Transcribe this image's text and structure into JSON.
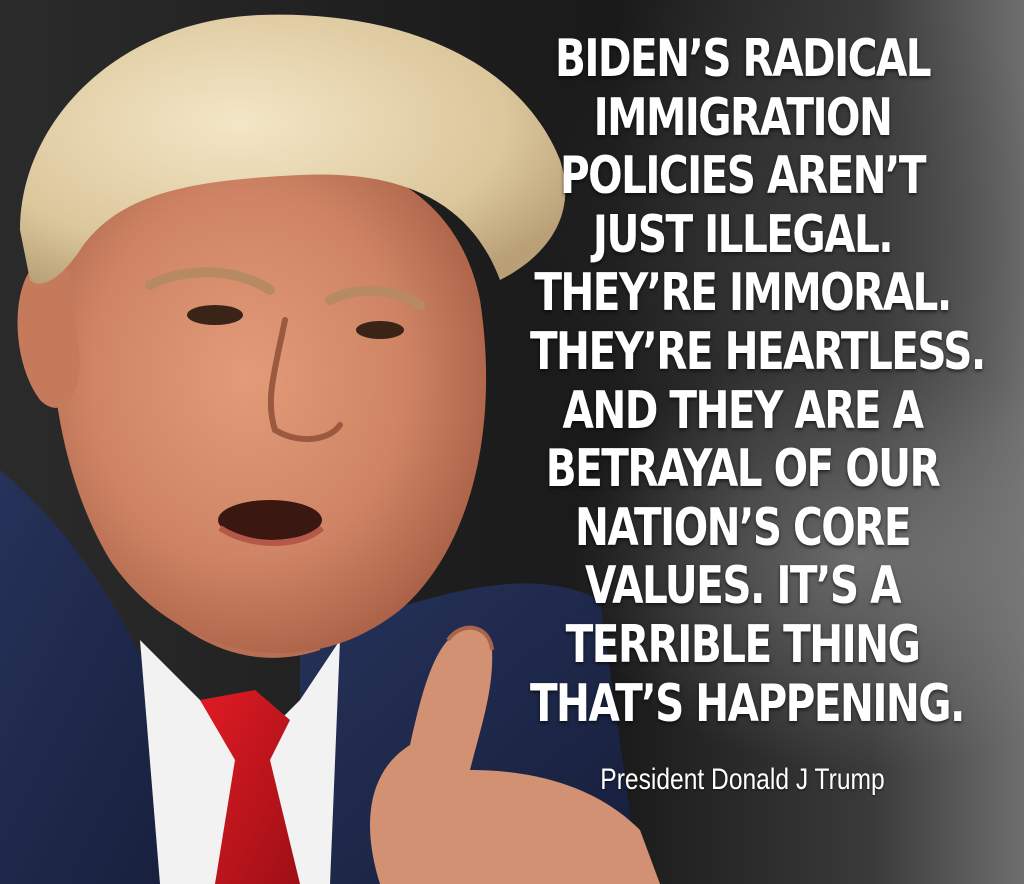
{
  "quote": {
    "lines": [
      "BIDEN’S RADICAL",
      "IMMIGRATION",
      "POLICIES AREN’T",
      "JUST ILLEGAL.",
      "THEY’RE IMMORAL.",
      "THEY’RE HEARTLESS.",
      "AND THEY ARE A",
      "BETRAYAL OF OUR",
      "NATION’S CORE",
      "VALUES. IT’S A",
      "TERRIBLE THING",
      "THAT’S HAPPENING."
    ],
    "attribution": "President Donald J Trump"
  },
  "colors": {
    "text": "#ffffff",
    "suit": "#1f2b4f",
    "tie": "#c8141c",
    "shirt": "#f2f2f2",
    "skin": "#d98f6e",
    "hair": "#e8d7b0"
  }
}
